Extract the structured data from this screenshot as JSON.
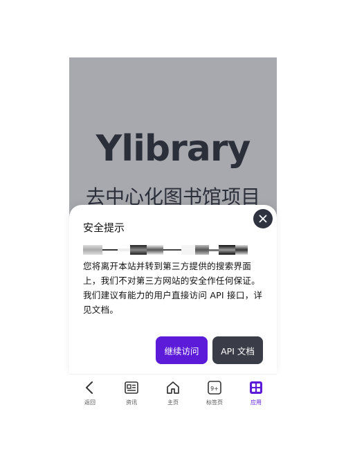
{
  "hero": {
    "title": "Ylibrary",
    "subtitle": "去中心化图书馆项目"
  },
  "dialog": {
    "title": "安全提示",
    "message": "您将离开本站并转到第三方提供的搜索界面上，我们不对第三方网站的安全作任何保证。我们建议有能力的用户直接访问 API 接口，详见文档。",
    "continue_label": "继续访问",
    "api_label": "API 文档",
    "close_icon": "close-icon"
  },
  "tabbar": {
    "items": [
      {
        "label": "返回",
        "icon": "back-icon"
      },
      {
        "label": "资讯",
        "icon": "news-icon"
      },
      {
        "label": "主页",
        "icon": "home-icon"
      },
      {
        "label": "标签页",
        "icon": "tabs-icon",
        "badge": "9+"
      },
      {
        "label": "应用",
        "icon": "apps-icon",
        "active": true
      }
    ]
  },
  "colors": {
    "accent": "#5b1bd8",
    "dark_button": "#3a3d47",
    "hero_bg": "#a8a9ae"
  }
}
